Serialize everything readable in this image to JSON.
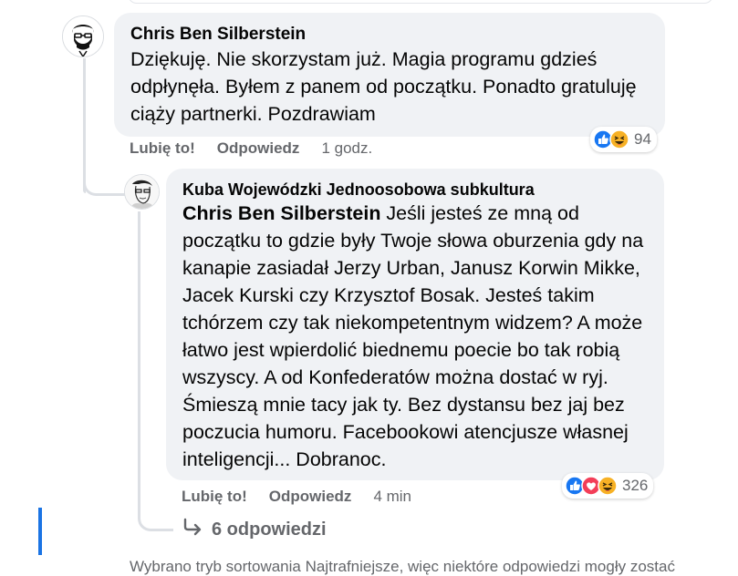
{
  "comment1": {
    "author": "Chris Ben Silberstein",
    "text": "Dziękuję. Nie skorzystam już. Magia programu gdzieś odpłynęła. Byłem z panem od początku. Ponadto gratuluję ciąży partnerki. Pozdrawiam",
    "like_label": "Lubię to!",
    "reply_label": "Odpowiedz",
    "time": "1 godz.",
    "reaction_count": "94",
    "reaction_icons": [
      "like-icon",
      "haha-icon"
    ]
  },
  "comment2": {
    "author": "Kuba Wojewódzki Jednoosobowa subkultura",
    "mention": "Chris Ben Silberstein",
    "text": " Jeśli jesteś ze mną od początku to gdzie były Twoje słowa oburzenia gdy na kanapie zasiadał Jerzy Urban, Janusz Korwin Mikke, Jacek Kurski czy Krzysztof Bosak. Jesteś takim tchórzem czy tak niekompetentnym widzem? A może łatwo jest wpierdolić biednemu poecie bo tak robią wszyscy. A od Konfederatów można dostać w ryj. Śmieszą mnie tacy jak ty. Bez dystansu bez jaj bez poczucia humoru. Facebookowi atencjusze własnej inteligencji... Dobranoc.",
    "like_label": "Lubię to!",
    "reply_label": "Odpowiedz",
    "time": "4 min",
    "reaction_count": "326",
    "reaction_icons": [
      "like-icon",
      "love-icon",
      "haha-icon"
    ]
  },
  "replies_link": "6 odpowiedzi",
  "footer_note": "Wybrano tryb sortowania Najtrafniejsze, więc niektóre odpowiedzi mogły zostać",
  "colors": {
    "bubble": "#f0f2f5",
    "meta_text": "#65676b",
    "like_blue": "#1877f2",
    "love_red": "#f33e58",
    "haha_yellow": "#f7b125",
    "accent": "#1b74e4"
  }
}
